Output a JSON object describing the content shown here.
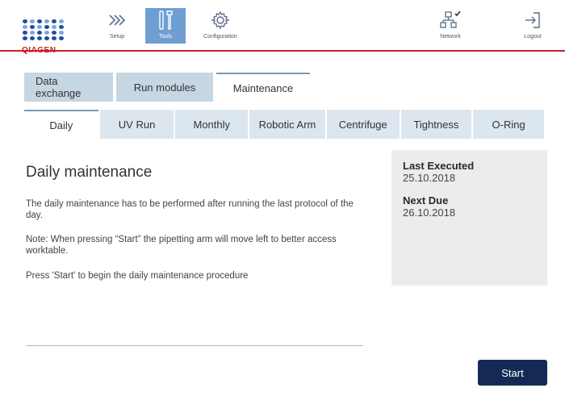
{
  "header": {
    "logo_text": "QIAGEN",
    "nav": {
      "setup": "Setup",
      "tools": "Tools",
      "configuration": "Configuration",
      "network": "Network",
      "logout": "Logout"
    },
    "active_nav": "Tools",
    "colors": {
      "accent": "#c8202c",
      "active_nav_bg": "#6f9ed2",
      "brand_blue": "#1e4fa0"
    }
  },
  "main_tabs": [
    {
      "label": "Data exchange",
      "active": false
    },
    {
      "label": "Run modules",
      "active": false
    },
    {
      "label": "Maintenance",
      "active": true
    }
  ],
  "sub_tabs": [
    {
      "label": "Daily",
      "active": true
    },
    {
      "label": "UV Run",
      "active": false
    },
    {
      "label": "Monthly",
      "active": false
    },
    {
      "label": "Robotic Arm",
      "active": false
    },
    {
      "label": "Centrifuge",
      "active": false
    },
    {
      "label": "Tightness",
      "active": false
    },
    {
      "label": "O-Ring",
      "active": false
    }
  ],
  "content": {
    "title": "Daily maintenance",
    "paragraphs": [
      "The daily maintenance has to be performed after running the last protocol of the day.",
      "Note: When pressing “Start” the pipetting arm will move left to better access worktable.",
      "Press 'Start' to begin the daily maintenance procedure"
    ]
  },
  "info": {
    "last_executed_label": "Last Executed",
    "last_executed_value": "25.10.2018",
    "next_due_label": "Next Due",
    "next_due_value": "26.10.2018"
  },
  "actions": {
    "start_label": "Start",
    "start_color": "#142a55"
  }
}
